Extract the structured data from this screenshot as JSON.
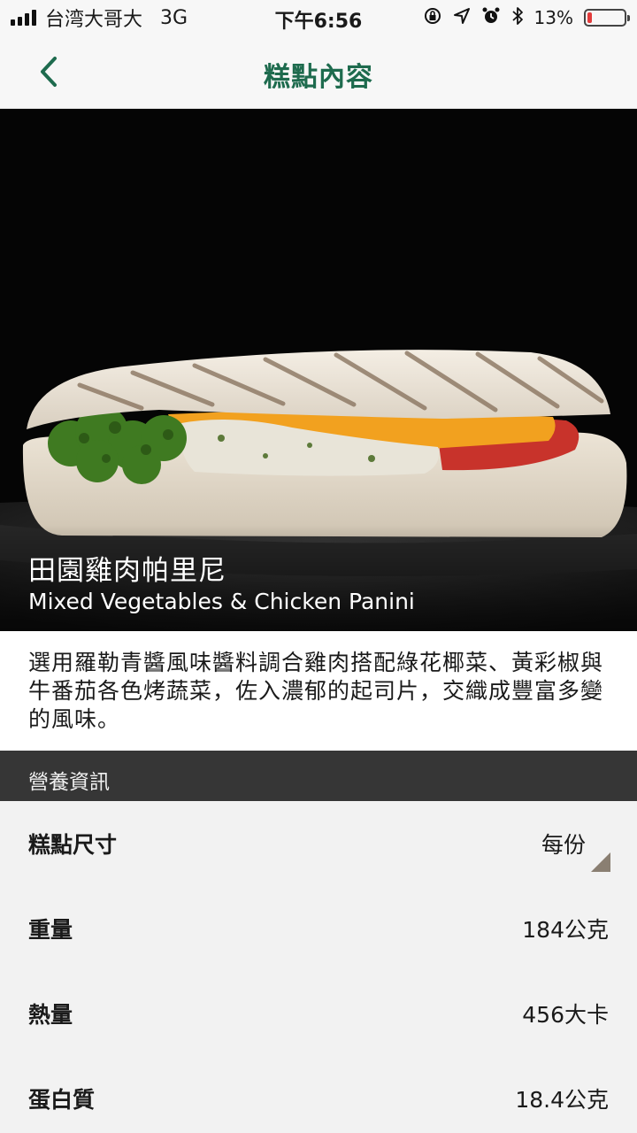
{
  "status_bar": {
    "carrier": "台湾大哥大",
    "network": "3G",
    "time": "下午6:56",
    "battery": "13%",
    "battery_level": 0.13
  },
  "nav": {
    "title": "糕點內容",
    "back_icon": "chevron-left-icon"
  },
  "product": {
    "name_zh": "田園雞肉帕里尼",
    "name_en": "Mixed Vegetables & Chicken Panini",
    "description": "選用羅勒青醬風味醬料調合雞肉搭配綠花椰菜、黃彩椒與牛番茄各色烤蔬菜，佐入濃郁的起司片，交織成豐富多變的風味。"
  },
  "nutrition": {
    "header": "營養資訊",
    "size_label": "糕點尺寸",
    "size_value": "每份",
    "rows": [
      {
        "label": "重量",
        "value": "184公克"
      },
      {
        "label": "熱量",
        "value": "456大卡"
      },
      {
        "label": "蛋白質",
        "value": "18.4公克"
      }
    ]
  },
  "colors": {
    "brand_green": "#1e6b4e",
    "section_header": "#363636",
    "battery_low": "#e23b3b"
  }
}
